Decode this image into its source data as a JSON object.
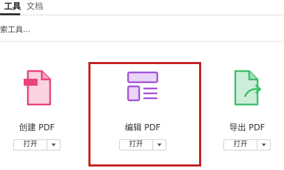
{
  "tabs": {
    "tools": "工具",
    "docs": "文档"
  },
  "search": {
    "placeholder": "索工具..."
  },
  "tools": {
    "create": {
      "label": "创建 PDF",
      "open_label": "打开",
      "icon": "create-pdf-icon",
      "color": "#e8437a"
    },
    "edit": {
      "label": "编辑 PDF",
      "open_label": "打开",
      "icon": "edit-pdf-icon",
      "color": "#a356d6"
    },
    "export": {
      "label": "导出 PDF",
      "open_label": "打开",
      "icon": "export-pdf-icon",
      "color": "#3dbf6a"
    }
  },
  "highlight_color": "#c41f1f"
}
